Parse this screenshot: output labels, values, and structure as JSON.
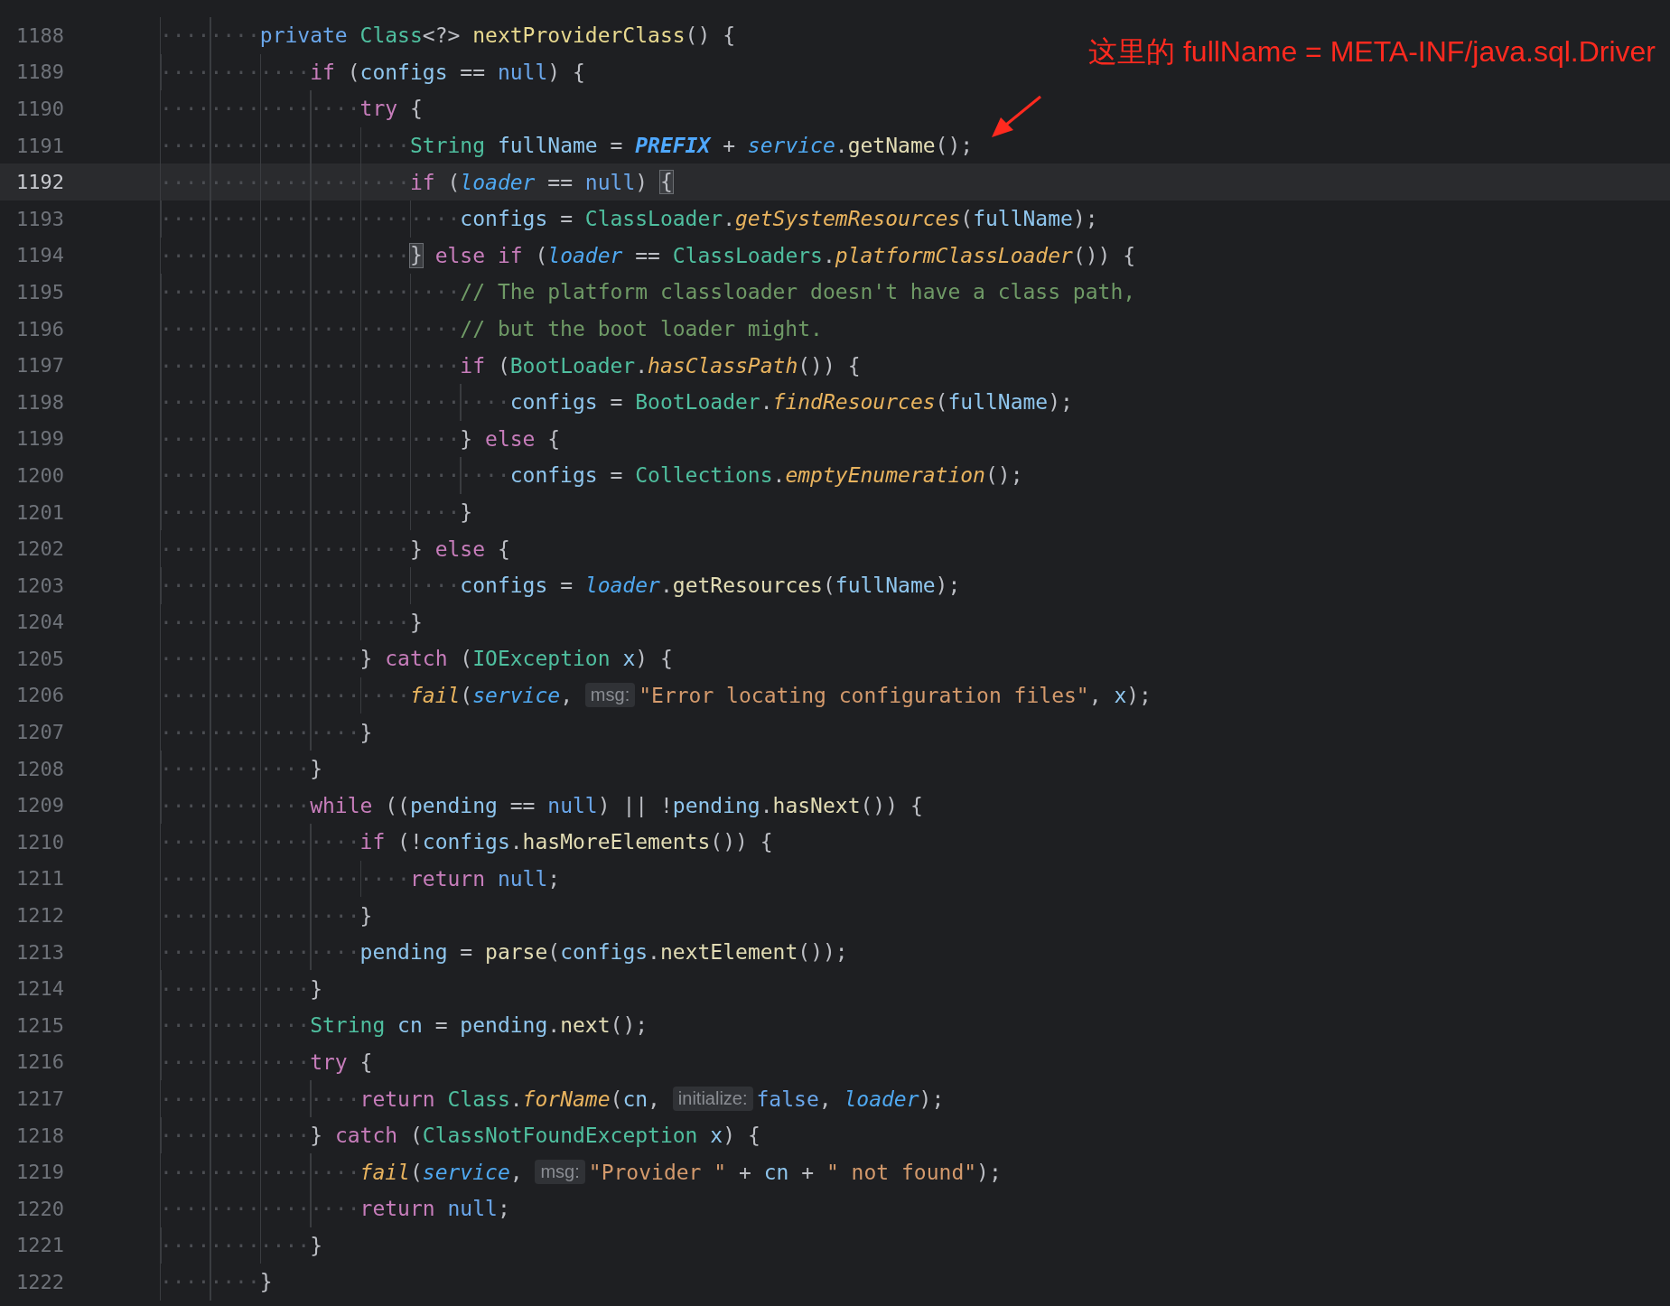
{
  "editor": {
    "lines": [
      {
        "number": "1188",
        "current": false,
        "tokens": [
          {
            "text": "········",
            "kind": "ws"
          },
          {
            "text": "private ",
            "kind": "mod"
          },
          {
            "text": "Class",
            "kind": "type"
          },
          {
            "text": "<?> ",
            "kind": "punct"
          },
          {
            "text": "nextProviderClass",
            "kind": "decl"
          },
          {
            "text": "() {",
            "kind": "punct"
          }
        ]
      },
      {
        "number": "1189",
        "current": false,
        "tokens": [
          {
            "text": "············",
            "kind": "ws"
          },
          {
            "text": "if",
            "kind": "kw"
          },
          {
            "text": " (",
            "kind": "punct"
          },
          {
            "text": "configs",
            "kind": "var"
          },
          {
            "text": " == ",
            "kind": "punct"
          },
          {
            "text": "null",
            "kind": "lit"
          },
          {
            "text": ") {",
            "kind": "punct"
          }
        ]
      },
      {
        "number": "1190",
        "current": false,
        "tokens": [
          {
            "text": "················",
            "kind": "ws"
          },
          {
            "text": "try",
            "kind": "kw"
          },
          {
            "text": " {",
            "kind": "punct"
          }
        ]
      },
      {
        "number": "1191",
        "current": false,
        "tokens": [
          {
            "text": "····················",
            "kind": "ws"
          },
          {
            "text": "String ",
            "kind": "type"
          },
          {
            "text": "fullName",
            "kind": "var"
          },
          {
            "text": " = ",
            "kind": "punct"
          },
          {
            "text": "PREFIX",
            "kind": "const"
          },
          {
            "text": " + ",
            "kind": "punct"
          },
          {
            "text": "service",
            "kind": "param"
          },
          {
            "text": ".",
            "kind": "punct"
          },
          {
            "text": "getName",
            "kind": "call"
          },
          {
            "text": "();",
            "kind": "punct"
          }
        ]
      },
      {
        "number": "1192",
        "current": true,
        "tokens": [
          {
            "text": "····················",
            "kind": "ws"
          },
          {
            "text": "if",
            "kind": "kw"
          },
          {
            "text": " (",
            "kind": "punct"
          },
          {
            "text": "loader",
            "kind": "param"
          },
          {
            "text": " == ",
            "kind": "punct"
          },
          {
            "text": "null",
            "kind": "lit"
          },
          {
            "text": ") ",
            "kind": "punct"
          },
          {
            "text": "{",
            "kind": "brace"
          }
        ]
      },
      {
        "number": "1193",
        "current": false,
        "tokens": [
          {
            "text": "························",
            "kind": "ws"
          },
          {
            "text": "configs",
            "kind": "var"
          },
          {
            "text": " = ",
            "kind": "punct"
          },
          {
            "text": "ClassLoader",
            "kind": "type"
          },
          {
            "text": ".",
            "kind": "punct"
          },
          {
            "text": "getSystemResources",
            "kind": "static"
          },
          {
            "text": "(",
            "kind": "punct"
          },
          {
            "text": "fullName",
            "kind": "var"
          },
          {
            "text": ");",
            "kind": "punct"
          }
        ]
      },
      {
        "number": "1194",
        "current": false,
        "tokens": [
          {
            "text": "····················",
            "kind": "ws"
          },
          {
            "text": "}",
            "kind": "brace"
          },
          {
            "text": " else if",
            "kind": "kw"
          },
          {
            "text": " (",
            "kind": "punct"
          },
          {
            "text": "loader",
            "kind": "param"
          },
          {
            "text": " == ",
            "kind": "punct"
          },
          {
            "text": "ClassLoaders",
            "kind": "type"
          },
          {
            "text": ".",
            "kind": "punct"
          },
          {
            "text": "platformClassLoader",
            "kind": "static"
          },
          {
            "text": "()) {",
            "kind": "punct"
          }
        ]
      },
      {
        "number": "1195",
        "current": false,
        "tokens": [
          {
            "text": "························",
            "kind": "ws"
          },
          {
            "text": "// The platform classloader doesn't have a class path,",
            "kind": "comment"
          }
        ]
      },
      {
        "number": "1196",
        "current": false,
        "tokens": [
          {
            "text": "························",
            "kind": "ws"
          },
          {
            "text": "// but the boot loader might.",
            "kind": "comment"
          }
        ]
      },
      {
        "number": "1197",
        "current": false,
        "tokens": [
          {
            "text": "························",
            "kind": "ws"
          },
          {
            "text": "if",
            "kind": "kw"
          },
          {
            "text": " (",
            "kind": "punct"
          },
          {
            "text": "BootLoader",
            "kind": "type"
          },
          {
            "text": ".",
            "kind": "punct"
          },
          {
            "text": "hasClassPath",
            "kind": "static"
          },
          {
            "text": "()) {",
            "kind": "punct"
          }
        ]
      },
      {
        "number": "1198",
        "current": false,
        "tokens": [
          {
            "text": "····························",
            "kind": "ws"
          },
          {
            "text": "configs",
            "kind": "var"
          },
          {
            "text": " = ",
            "kind": "punct"
          },
          {
            "text": "BootLoader",
            "kind": "type"
          },
          {
            "text": ".",
            "kind": "punct"
          },
          {
            "text": "findResources",
            "kind": "static"
          },
          {
            "text": "(",
            "kind": "punct"
          },
          {
            "text": "fullName",
            "kind": "var"
          },
          {
            "text": ");",
            "kind": "punct"
          }
        ]
      },
      {
        "number": "1199",
        "current": false,
        "tokens": [
          {
            "text": "························",
            "kind": "ws"
          },
          {
            "text": "} ",
            "kind": "punct"
          },
          {
            "text": "else",
            "kind": "kw"
          },
          {
            "text": " {",
            "kind": "punct"
          }
        ]
      },
      {
        "number": "1200",
        "current": false,
        "tokens": [
          {
            "text": "····························",
            "kind": "ws"
          },
          {
            "text": "configs",
            "kind": "var"
          },
          {
            "text": " = ",
            "kind": "punct"
          },
          {
            "text": "Collections",
            "kind": "type"
          },
          {
            "text": ".",
            "kind": "punct"
          },
          {
            "text": "emptyEnumeration",
            "kind": "static"
          },
          {
            "text": "();",
            "kind": "punct"
          }
        ]
      },
      {
        "number": "1201",
        "current": false,
        "tokens": [
          {
            "text": "························",
            "kind": "ws"
          },
          {
            "text": "}",
            "kind": "punct"
          }
        ]
      },
      {
        "number": "1202",
        "current": false,
        "tokens": [
          {
            "text": "····················",
            "kind": "ws"
          },
          {
            "text": "} ",
            "kind": "punct"
          },
          {
            "text": "else",
            "kind": "kw"
          },
          {
            "text": " {",
            "kind": "punct"
          }
        ]
      },
      {
        "number": "1203",
        "current": false,
        "tokens": [
          {
            "text": "························",
            "kind": "ws"
          },
          {
            "text": "configs",
            "kind": "var"
          },
          {
            "text": " = ",
            "kind": "punct"
          },
          {
            "text": "loader",
            "kind": "param"
          },
          {
            "text": ".",
            "kind": "punct"
          },
          {
            "text": "getResources",
            "kind": "call"
          },
          {
            "text": "(",
            "kind": "punct"
          },
          {
            "text": "fullName",
            "kind": "var"
          },
          {
            "text": ");",
            "kind": "punct"
          }
        ]
      },
      {
        "number": "1204",
        "current": false,
        "tokens": [
          {
            "text": "····················",
            "kind": "ws"
          },
          {
            "text": "}",
            "kind": "punct"
          }
        ]
      },
      {
        "number": "1205",
        "current": false,
        "tokens": [
          {
            "text": "················",
            "kind": "ws"
          },
          {
            "text": "} ",
            "kind": "punct"
          },
          {
            "text": "catch",
            "kind": "kw"
          },
          {
            "text": " (",
            "kind": "punct"
          },
          {
            "text": "IOException ",
            "kind": "type"
          },
          {
            "text": "x",
            "kind": "var"
          },
          {
            "text": ") {",
            "kind": "punct"
          }
        ]
      },
      {
        "number": "1206",
        "current": false,
        "tokens": [
          {
            "text": "····················",
            "kind": "ws"
          },
          {
            "text": "fail",
            "kind": "static"
          },
          {
            "text": "(",
            "kind": "punct"
          },
          {
            "text": "service",
            "kind": "param"
          },
          {
            "text": ", ",
            "kind": "punct"
          },
          {
            "text": "msg:",
            "kind": "hint"
          },
          {
            "text": "\"Error locating configuration files\"",
            "kind": "str"
          },
          {
            "text": ", ",
            "kind": "punct"
          },
          {
            "text": "x",
            "kind": "var"
          },
          {
            "text": ");",
            "kind": "punct"
          }
        ]
      },
      {
        "number": "1207",
        "current": false,
        "tokens": [
          {
            "text": "················",
            "kind": "ws"
          },
          {
            "text": "}",
            "kind": "punct"
          }
        ]
      },
      {
        "number": "1208",
        "current": false,
        "tokens": [
          {
            "text": "············",
            "kind": "ws"
          },
          {
            "text": "}",
            "kind": "punct"
          }
        ]
      },
      {
        "number": "1209",
        "current": false,
        "tokens": [
          {
            "text": "············",
            "kind": "ws"
          },
          {
            "text": "while",
            "kind": "kw"
          },
          {
            "text": " ((",
            "kind": "punct"
          },
          {
            "text": "pending",
            "kind": "var"
          },
          {
            "text": " == ",
            "kind": "punct"
          },
          {
            "text": "null",
            "kind": "lit"
          },
          {
            "text": ") || !",
            "kind": "punct"
          },
          {
            "text": "pending",
            "kind": "var"
          },
          {
            "text": ".",
            "kind": "punct"
          },
          {
            "text": "hasNext",
            "kind": "call"
          },
          {
            "text": "()) {",
            "kind": "punct"
          }
        ]
      },
      {
        "number": "1210",
        "current": false,
        "tokens": [
          {
            "text": "················",
            "kind": "ws"
          },
          {
            "text": "if",
            "kind": "kw"
          },
          {
            "text": " (!",
            "kind": "punct"
          },
          {
            "text": "configs",
            "kind": "var"
          },
          {
            "text": ".",
            "kind": "punct"
          },
          {
            "text": "hasMoreElements",
            "kind": "call"
          },
          {
            "text": "()) {",
            "kind": "punct"
          }
        ]
      },
      {
        "number": "1211",
        "current": false,
        "tokens": [
          {
            "text": "····················",
            "kind": "ws"
          },
          {
            "text": "return ",
            "kind": "kw"
          },
          {
            "text": "null",
            "kind": "lit"
          },
          {
            "text": ";",
            "kind": "punct"
          }
        ]
      },
      {
        "number": "1212",
        "current": false,
        "tokens": [
          {
            "text": "················",
            "kind": "ws"
          },
          {
            "text": "}",
            "kind": "punct"
          }
        ]
      },
      {
        "number": "1213",
        "current": false,
        "tokens": [
          {
            "text": "················",
            "kind": "ws"
          },
          {
            "text": "pending",
            "kind": "var"
          },
          {
            "text": " = ",
            "kind": "punct"
          },
          {
            "text": "parse",
            "kind": "call"
          },
          {
            "text": "(",
            "kind": "punct"
          },
          {
            "text": "configs",
            "kind": "var"
          },
          {
            "text": ".",
            "kind": "punct"
          },
          {
            "text": "nextElement",
            "kind": "call"
          },
          {
            "text": "());",
            "kind": "punct"
          }
        ]
      },
      {
        "number": "1214",
        "current": false,
        "tokens": [
          {
            "text": "············",
            "kind": "ws"
          },
          {
            "text": "}",
            "kind": "punct"
          }
        ]
      },
      {
        "number": "1215",
        "current": false,
        "tokens": [
          {
            "text": "············",
            "kind": "ws"
          },
          {
            "text": "String ",
            "kind": "type"
          },
          {
            "text": "cn",
            "kind": "var"
          },
          {
            "text": " = ",
            "kind": "punct"
          },
          {
            "text": "pending",
            "kind": "var"
          },
          {
            "text": ".",
            "kind": "punct"
          },
          {
            "text": "next",
            "kind": "call"
          },
          {
            "text": "();",
            "kind": "punct"
          }
        ]
      },
      {
        "number": "1216",
        "current": false,
        "tokens": [
          {
            "text": "············",
            "kind": "ws"
          },
          {
            "text": "try",
            "kind": "kw"
          },
          {
            "text": " {",
            "kind": "punct"
          }
        ]
      },
      {
        "number": "1217",
        "current": false,
        "tokens": [
          {
            "text": "················",
            "kind": "ws"
          },
          {
            "text": "return ",
            "kind": "kw"
          },
          {
            "text": "Class",
            "kind": "type"
          },
          {
            "text": ".",
            "kind": "punct"
          },
          {
            "text": "forName",
            "kind": "static"
          },
          {
            "text": "(",
            "kind": "punct"
          },
          {
            "text": "cn",
            "kind": "var"
          },
          {
            "text": ", ",
            "kind": "punct"
          },
          {
            "text": "initialize:",
            "kind": "hint"
          },
          {
            "text": "false",
            "kind": "lit"
          },
          {
            "text": ", ",
            "kind": "punct"
          },
          {
            "text": "loader",
            "kind": "param"
          },
          {
            "text": ");",
            "kind": "punct"
          }
        ]
      },
      {
        "number": "1218",
        "current": false,
        "tokens": [
          {
            "text": "············",
            "kind": "ws"
          },
          {
            "text": "} ",
            "kind": "punct"
          },
          {
            "text": "catch",
            "kind": "kw"
          },
          {
            "text": " (",
            "kind": "punct"
          },
          {
            "text": "ClassNotFoundException ",
            "kind": "type"
          },
          {
            "text": "x",
            "kind": "var"
          },
          {
            "text": ") {",
            "kind": "punct"
          }
        ]
      },
      {
        "number": "1219",
        "current": false,
        "tokens": [
          {
            "text": "················",
            "kind": "ws"
          },
          {
            "text": "fail",
            "kind": "static"
          },
          {
            "text": "(",
            "kind": "punct"
          },
          {
            "text": "service",
            "kind": "param"
          },
          {
            "text": ", ",
            "kind": "punct"
          },
          {
            "text": "msg:",
            "kind": "hint"
          },
          {
            "text": "\"Provider \"",
            "kind": "str"
          },
          {
            "text": " + ",
            "kind": "punct"
          },
          {
            "text": "cn",
            "kind": "var"
          },
          {
            "text": " + ",
            "kind": "punct"
          },
          {
            "text": "\" not found\"",
            "kind": "str"
          },
          {
            "text": ");",
            "kind": "punct"
          }
        ]
      },
      {
        "number": "1220",
        "current": false,
        "tokens": [
          {
            "text": "················",
            "kind": "ws"
          },
          {
            "text": "return ",
            "kind": "kw"
          },
          {
            "text": "null",
            "kind": "lit"
          },
          {
            "text": ";",
            "kind": "punct"
          }
        ]
      },
      {
        "number": "1221",
        "current": false,
        "tokens": [
          {
            "text": "············",
            "kind": "ws"
          },
          {
            "text": "}",
            "kind": "punct"
          }
        ]
      },
      {
        "number": "1222",
        "current": false,
        "tokens": [
          {
            "text": "········",
            "kind": "ws"
          },
          {
            "text": "}",
            "kind": "punct"
          }
        ]
      }
    ]
  },
  "annotation": {
    "text": "这里的 fullName = META-INF/java.sql.Driver"
  }
}
